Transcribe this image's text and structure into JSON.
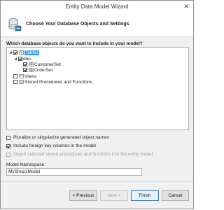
{
  "window": {
    "title": "Entity Data Model Wizard",
    "close_glyph": "✕"
  },
  "header": {
    "title": "Choose Your Database Objects and Settings",
    "icon": "wizard-database-icon"
  },
  "prompt": "Which database objects do you want to include in your model?",
  "tree": {
    "tables": {
      "label": "Tables",
      "checked": true,
      "expanded": true,
      "selected": true
    },
    "dbo": {
      "label": "dbo",
      "checked": true,
      "expanded": true
    },
    "customerset": {
      "label": "CustomerSet",
      "checked": true
    },
    "orderset": {
      "label": "OrderSet",
      "checked": true
    },
    "views": {
      "label": "Views",
      "checked": false
    },
    "stored_procs": {
      "label": "Stored Procedures and Functions",
      "checked": false
    }
  },
  "options": {
    "pluralize": {
      "label": "Pluralize or singularize generated object names",
      "checked": false
    },
    "foreign_keys": {
      "label": "Include foreign key columns in the model",
      "checked": true
    },
    "import_procs": {
      "label": "Import selected stored procedures and functions into the entity model",
      "checked": false,
      "disabled": true
    }
  },
  "namespace": {
    "label": "Model Namespace:",
    "value": "MyShop1Model"
  },
  "buttons": {
    "previous": "< Previous",
    "next": "Next >",
    "finish": "Finish",
    "cancel": "Cancel"
  },
  "colors": {
    "selection": "#3399ff",
    "window_bg": "#f0f0f0",
    "header_bg": "#ffffff"
  }
}
